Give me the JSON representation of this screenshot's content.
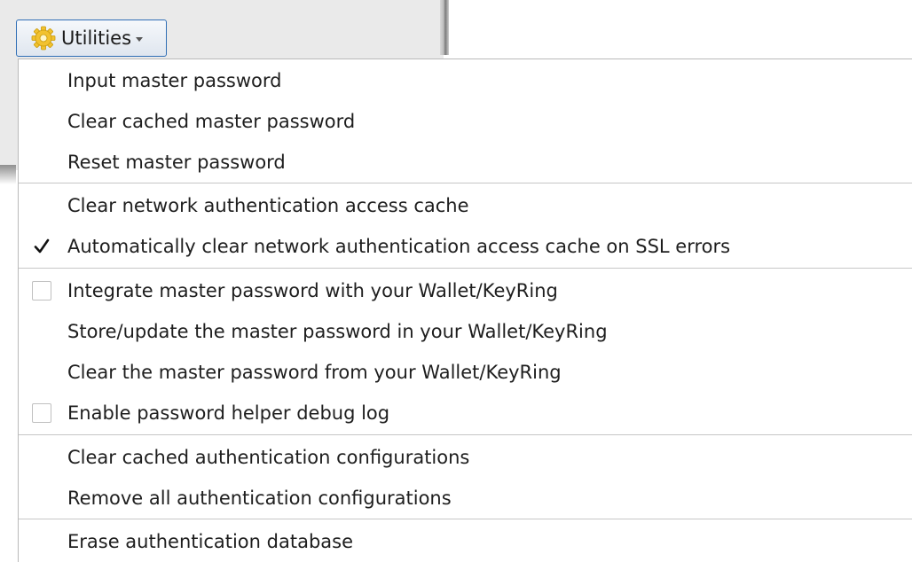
{
  "toolbar": {
    "utilities_label": "Utilities",
    "utilities_icon": "gear-icon"
  },
  "menu": {
    "items": [
      {
        "label": "Input master password"
      },
      {
        "label": "Clear cached master password"
      },
      {
        "label": "Reset master password"
      },
      {
        "label": "Clear network authentication access cache"
      },
      {
        "label": "Automatically clear network authentication access cache on SSL errors",
        "checkbox": true,
        "checked": true
      },
      {
        "label": "Integrate master password with your Wallet/KeyRing",
        "checkbox": true,
        "checked": false
      },
      {
        "label": "Store/update the master password in your Wallet/KeyRing"
      },
      {
        "label": "Clear the master password from your Wallet/KeyRing"
      },
      {
        "label": "Enable password helper debug log",
        "checkbox": true,
        "checked": false
      },
      {
        "label": "Clear cached authentication configurations"
      },
      {
        "label": "Remove all authentication configurations"
      },
      {
        "label": "Erase authentication database"
      }
    ]
  },
  "colors": {
    "button_border": "#2f6eb5",
    "gear_icon": "#e8b90c",
    "separator": "#c6c6c6"
  }
}
